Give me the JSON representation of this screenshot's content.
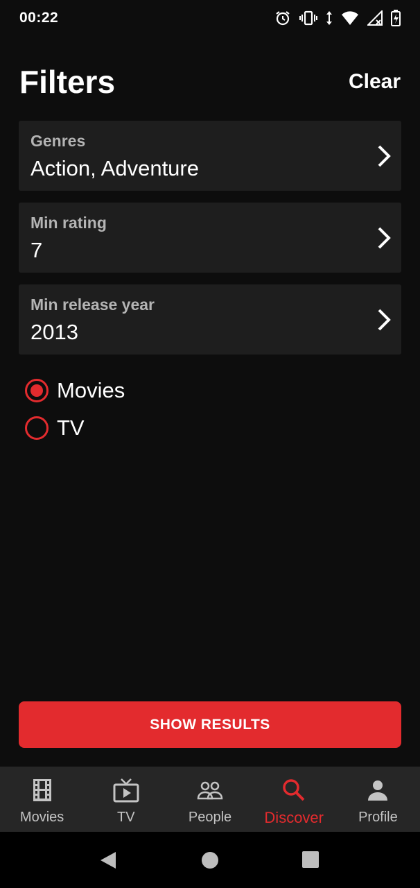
{
  "status_bar": {
    "time": "00:22"
  },
  "header": {
    "title": "Filters",
    "clear_label": "Clear"
  },
  "filters": [
    {
      "label": "Genres",
      "value": "Action, Adventure"
    },
    {
      "label": "Min rating",
      "value": "7"
    },
    {
      "label": "Min release year",
      "value": "2013"
    }
  ],
  "media_type": {
    "options": [
      {
        "label": "Movies",
        "selected": true
      },
      {
        "label": "TV",
        "selected": false
      }
    ]
  },
  "show_results_label": "SHOW RESULTS",
  "bottom_nav": {
    "items": [
      {
        "label": "Movies",
        "icon": "film-icon",
        "active": false
      },
      {
        "label": "TV",
        "icon": "tv-icon",
        "active": false
      },
      {
        "label": "People",
        "icon": "people-icon",
        "active": false
      },
      {
        "label": "Discover",
        "icon": "search-icon",
        "active": true
      },
      {
        "label": "Profile",
        "icon": "person-icon",
        "active": false
      }
    ]
  },
  "colors": {
    "accent": "#e32b2e",
    "background": "#0d0d0d",
    "card": "#1e1e1e",
    "nav": "#262626"
  }
}
